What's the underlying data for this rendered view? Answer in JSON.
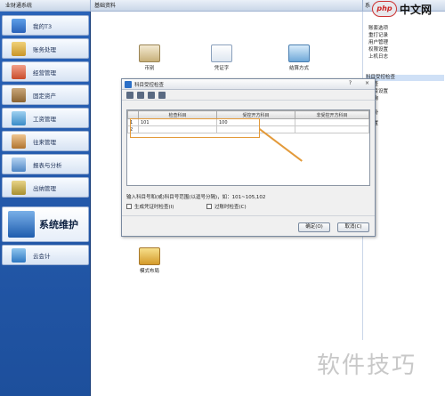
{
  "left_title": "业财通系统",
  "main_title": "基础资料",
  "right_title": "系",
  "sidebar": {
    "items": [
      {
        "label": "我的T3"
      },
      {
        "label": "账务处理"
      },
      {
        "label": "经营管理"
      },
      {
        "label": "固定资产"
      },
      {
        "label": "工资管理"
      },
      {
        "label": "往来管理"
      },
      {
        "label": "报表与分析"
      },
      {
        "label": "出纳管理"
      },
      {
        "label": "系统维护"
      },
      {
        "label": "云会计"
      }
    ]
  },
  "right_panel": {
    "items": [
      "账套选项",
      "重打记录",
      "用户管理",
      "权限设置",
      "上机日志",
      "科目受控检查",
      "检查",
      "科目设置",
      "查询",
      "备份",
      "设置"
    ]
  },
  "desk_icons": [
    {
      "label": "币别"
    },
    {
      "label": "凭证字"
    },
    {
      "label": "结算方式"
    },
    {
      "label": "模式布局"
    }
  ],
  "dialog": {
    "title": "科目受控检查",
    "help": "?",
    "close": "×",
    "columns": [
      "检查科目",
      "受控开方科目",
      "非受控开方科目"
    ],
    "rows": [
      {
        "num": "1",
        "a": "101",
        "b": "100",
        "c": ""
      },
      {
        "num": "2",
        "a": "",
        "b": "",
        "c": ""
      }
    ],
    "hint": "输入科目号和(或)科目号范围(以逗号分隔)，如：101~105,102",
    "check1": "生成凭证时检查(I)",
    "check2": "过账时检查(C)",
    "ok": "确定(O)",
    "cancel": "取消(C)"
  },
  "watermark": {
    "top_logo": "php",
    "top_text": "中文网",
    "bottom_text": "软件技巧"
  },
  "colors": {
    "sidebar_bg": "#1d4f9c",
    "highlight": "#e39a3a",
    "accent": "#2b6fc7"
  }
}
